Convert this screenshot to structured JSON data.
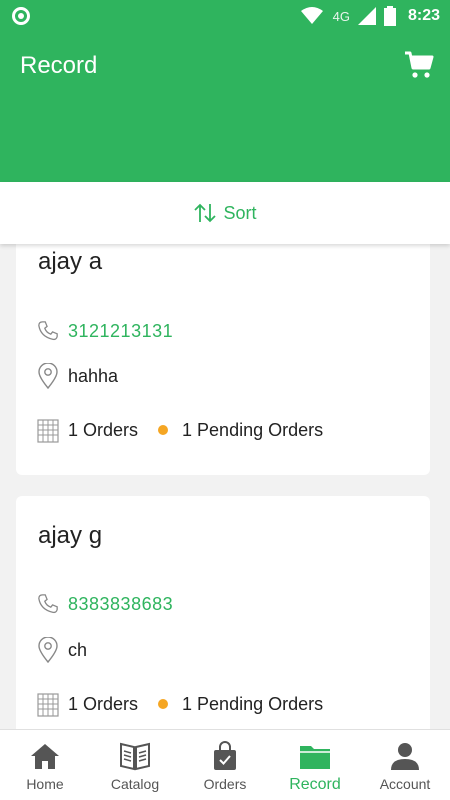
{
  "status_bar": {
    "network": "4G",
    "time": "8:23"
  },
  "header": {
    "title": "Record",
    "cart_icon": "cart-icon"
  },
  "sort": {
    "label": "Sort",
    "icon": "sort-arrows-icon"
  },
  "records": [
    {
      "name": "ajay a",
      "phone": "3121213131",
      "address": "hahha",
      "orders": "1 Orders",
      "pending": "1 Pending Orders"
    },
    {
      "name": "ajay g",
      "phone": "8383838683",
      "address": "ch",
      "orders": "1 Orders",
      "pending": "1 Pending Orders"
    }
  ],
  "bottom_nav": [
    {
      "label": "Home",
      "icon": "home-icon",
      "active": false
    },
    {
      "label": "Catalog",
      "icon": "catalog-icon",
      "active": false
    },
    {
      "label": "Orders",
      "icon": "orders-bag-icon",
      "active": false
    },
    {
      "label": "Record",
      "icon": "folder-icon",
      "active": true
    },
    {
      "label": "Account",
      "icon": "account-icon",
      "active": false
    }
  ],
  "colors": {
    "primary": "#2fb45e",
    "pending_dot": "#f5a623",
    "background": "#f2f2f2"
  }
}
